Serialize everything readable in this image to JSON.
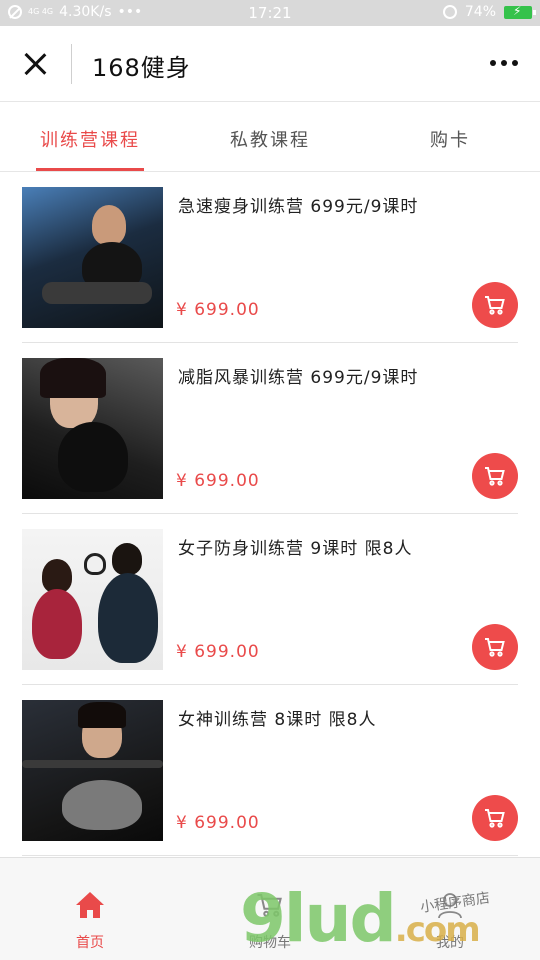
{
  "status_bar": {
    "network": "4.30K/s",
    "dots": "•••",
    "time": "17:21",
    "battery": "74%",
    "net_label": "4G 4G"
  },
  "header": {
    "title": "168健身"
  },
  "tabs": [
    {
      "label": "训练营课程",
      "active": true
    },
    {
      "label": "私教课程",
      "active": false
    },
    {
      "label": "购卡",
      "active": false
    }
  ],
  "products": [
    {
      "title": "急速瘦身训练营 699元/9课时",
      "price": "¥ 699.00"
    },
    {
      "title": "减脂风暴训练营 699元/9课时",
      "price": "¥ 699.00"
    },
    {
      "title": "女子防身训练营 9课时 限8人",
      "price": "¥ 699.00"
    },
    {
      "title": "女神训练营 8课时 限8人",
      "price": "¥ 699.00"
    }
  ],
  "bottom_nav": [
    {
      "label": "首页",
      "icon": "home-icon",
      "active": true
    },
    {
      "label": "购物车",
      "icon": "cart-icon",
      "active": false
    },
    {
      "label": "我的",
      "icon": "user-icon",
      "active": false
    }
  ],
  "watermark": {
    "text": "9lud",
    "suffix": ".com",
    "sub": "小程序商店"
  },
  "colors": {
    "accent": "#e94a4a",
    "cart_button": "#ee4b4b"
  }
}
